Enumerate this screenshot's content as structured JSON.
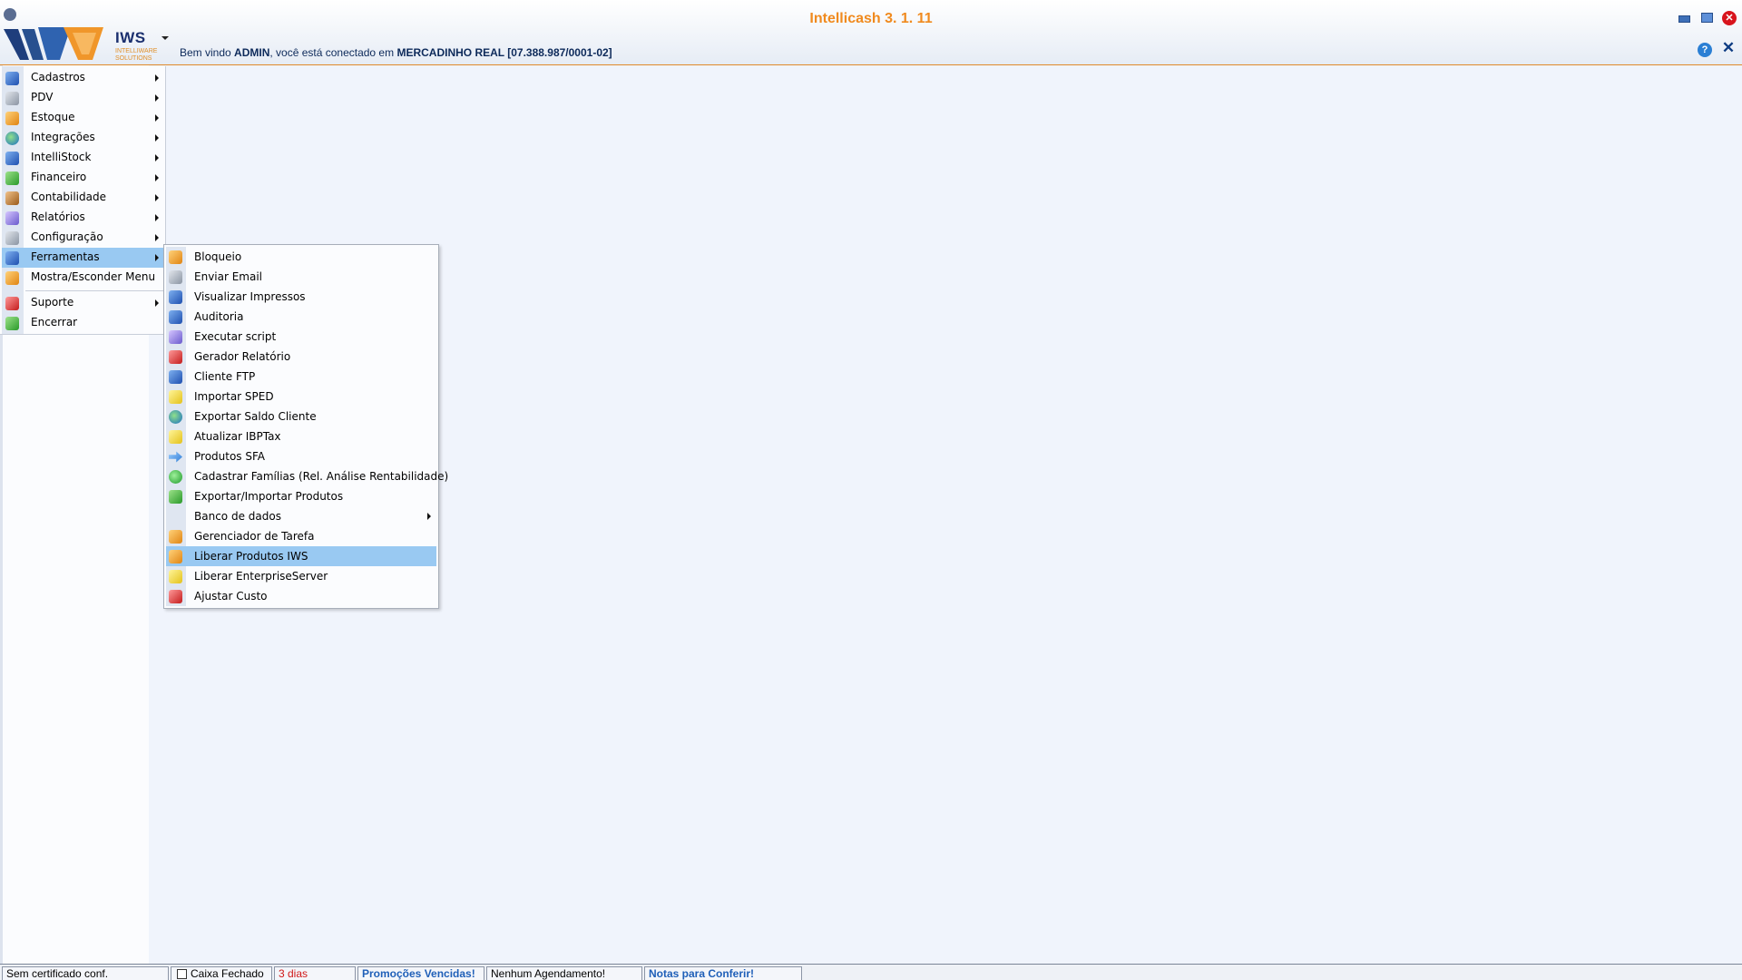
{
  "app": {
    "title": "Intellicash 3. 1. 11",
    "logo_text": "IWS",
    "logo_sub_1": "INTELLIWARE",
    "logo_sub_2": "SOLUTIONS"
  },
  "welcome": {
    "prefix": "Bem vindo ",
    "user": "ADMIN",
    "middle": ", você está conectado em ",
    "company": "MERCADINHO REAL [07.388.987/0001-02]"
  },
  "window_controls": {
    "close_glyph": "✕",
    "help_glyph": "?",
    "close_x_glyph": "✕"
  },
  "main_menu": {
    "items": [
      {
        "label": "Cadastros",
        "icon": "cadastros-icon"
      },
      {
        "label": "PDV",
        "icon": "pdv-icon"
      },
      {
        "label": "Estoque",
        "icon": "estoque-icon"
      },
      {
        "label": "Integrações",
        "icon": "at-sign-icon"
      },
      {
        "label": "IntelliStock",
        "icon": "phone-device-icon"
      },
      {
        "label": "Financeiro",
        "icon": "money-icon"
      },
      {
        "label": "Contabilidade",
        "icon": "ledger-icon"
      },
      {
        "label": "Relatórios",
        "icon": "report-icon"
      },
      {
        "label": "Configuração",
        "icon": "config-icon"
      },
      {
        "label": "Ferramentas",
        "icon": "tools-icon"
      },
      {
        "label": "Mostra/Esconder Menu",
        "icon": "toggle-menu-icon"
      },
      {
        "label": "Suporte",
        "icon": "support-icon"
      },
      {
        "label": "Encerrar",
        "icon": "exit-icon"
      }
    ]
  },
  "sub_menu": {
    "items": [
      {
        "label": "Bloqueio"
      },
      {
        "label": "Enviar Email"
      },
      {
        "label": "Visualizar Impressos"
      },
      {
        "label": "Auditoria"
      },
      {
        "label": "Executar script"
      },
      {
        "label": "Gerador Relatório"
      },
      {
        "label": "Cliente FTP"
      },
      {
        "label": "Importar SPED"
      },
      {
        "label": "Exportar Saldo Cliente"
      },
      {
        "label": "Atualizar IBPTax"
      },
      {
        "label": "Produtos SFA"
      },
      {
        "label": "Cadastrar Famílias (Rel. Análise Rentabilidade)"
      },
      {
        "label": "Exportar/Importar Produtos"
      },
      {
        "label": "Banco de dados"
      },
      {
        "label": "Gerenciador de Tarefa"
      },
      {
        "label": "Liberar Produtos IWS"
      },
      {
        "label": "Liberar EnterpriseServer"
      },
      {
        "label": "Ajustar Custo"
      }
    ]
  },
  "status_bar": {
    "certificate": "Sem certificado conf.",
    "cash": "Caixa Fechado",
    "days": "3 dias",
    "promotions": "Promoções Vencidas!",
    "schedule": "Nenhum Agendamento!",
    "notes": "Notas para Conferir!"
  },
  "colors": {
    "accent": "#f08a1e",
    "highlight": "#99c9f2",
    "welcome_text": "#0d2a5a"
  }
}
